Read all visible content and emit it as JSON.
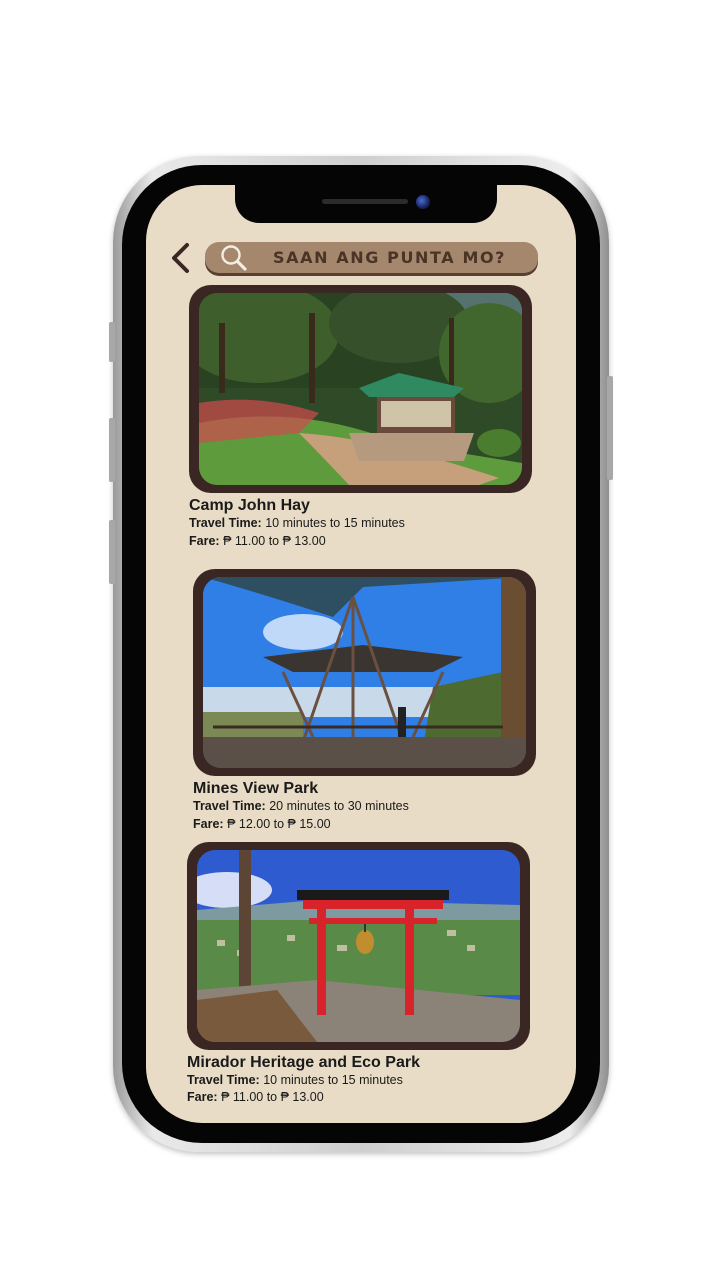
{
  "search": {
    "placeholder": "SAAN ANG PUNTA MO?"
  },
  "nav": {
    "back_icon": "chevron-left-icon"
  },
  "colors": {
    "screen_bg": "#e9dcc7",
    "search_bg": "#a4876d",
    "card_frame": "#3a2723"
  },
  "places": [
    {
      "name": "Camp John Hay",
      "travel_label": "Travel Time:",
      "travel_time": "10 minutes to 15 minutes",
      "fare_label": "Fare:",
      "fare": "₱ 11.00 to ₱ 13.00"
    },
    {
      "name": "Mines View Park",
      "travel_label": "Travel Time:",
      "travel_time": "20 minutes to 30 minutes",
      "fare_label": "Fare:",
      "fare": "₱ 12.00 to ₱ 15.00"
    },
    {
      "name": "Mirador Heritage and Eco Park",
      "travel_label": "Travel Time:",
      "travel_time": "10 minutes to 15 minutes",
      "fare_label": "Fare:",
      "fare": "₱ 11.00 to ₱ 13.00"
    }
  ]
}
